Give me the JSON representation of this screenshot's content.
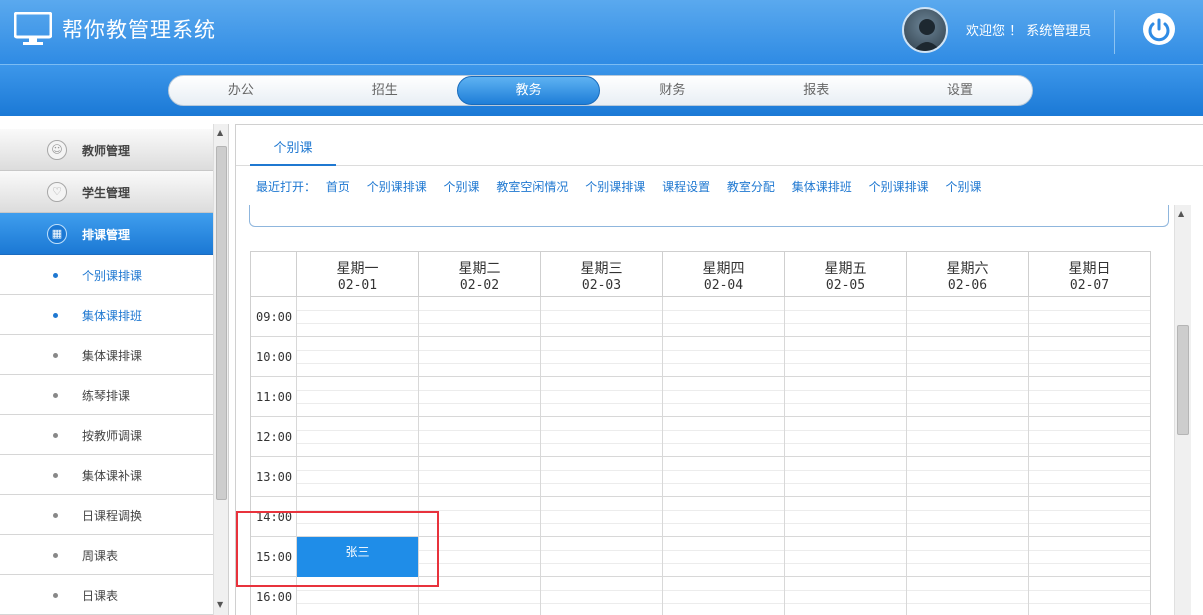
{
  "app": {
    "title": "帮你教管理系统",
    "welcome": "欢迎您 ！ 系统管理员"
  },
  "nav": {
    "tabs": [
      "办公",
      "招生",
      "教务",
      "财务",
      "报表",
      "设置"
    ],
    "active": "教务"
  },
  "sidebar": {
    "groups": [
      {
        "label": "教师管理",
        "icon": "user-circle-icon"
      },
      {
        "label": "学生管理",
        "icon": "heart-icon"
      },
      {
        "label": "排课管理",
        "icon": "calendar-icon"
      }
    ],
    "items": [
      "个别课排课",
      "集体课排班",
      "集体课排课",
      "练琴排课",
      "按教师调课",
      "集体课补课",
      "日课程调换",
      "周课表",
      "日课表"
    ]
  },
  "main": {
    "tab": "个别课",
    "recent_label": "最近打开：",
    "recent_links": [
      "首页",
      "个别课排课",
      "个别课",
      "教室空闲情况",
      "个别课排课",
      "课程设置",
      "教室分配",
      "集体课排班",
      "个别课排课",
      "个别课"
    ]
  },
  "calendar": {
    "days": [
      {
        "weekday": "星期一",
        "date": "02-01"
      },
      {
        "weekday": "星期二",
        "date": "02-02"
      },
      {
        "weekday": "星期三",
        "date": "02-03"
      },
      {
        "weekday": "星期四",
        "date": "02-04"
      },
      {
        "weekday": "星期五",
        "date": "02-05"
      },
      {
        "weekday": "星期六",
        "date": "02-06"
      },
      {
        "weekday": "星期日",
        "date": "02-07"
      }
    ],
    "times": [
      "09:00",
      "10:00",
      "11:00",
      "12:00",
      "13:00",
      "14:00",
      "15:00",
      "16:00"
    ],
    "event": {
      "label": "张三",
      "day": "星期一",
      "time": "15:00"
    }
  },
  "colors": {
    "accent": "#1f78d1",
    "event": "#1f8de8",
    "highlight_box": "#e8323c"
  }
}
